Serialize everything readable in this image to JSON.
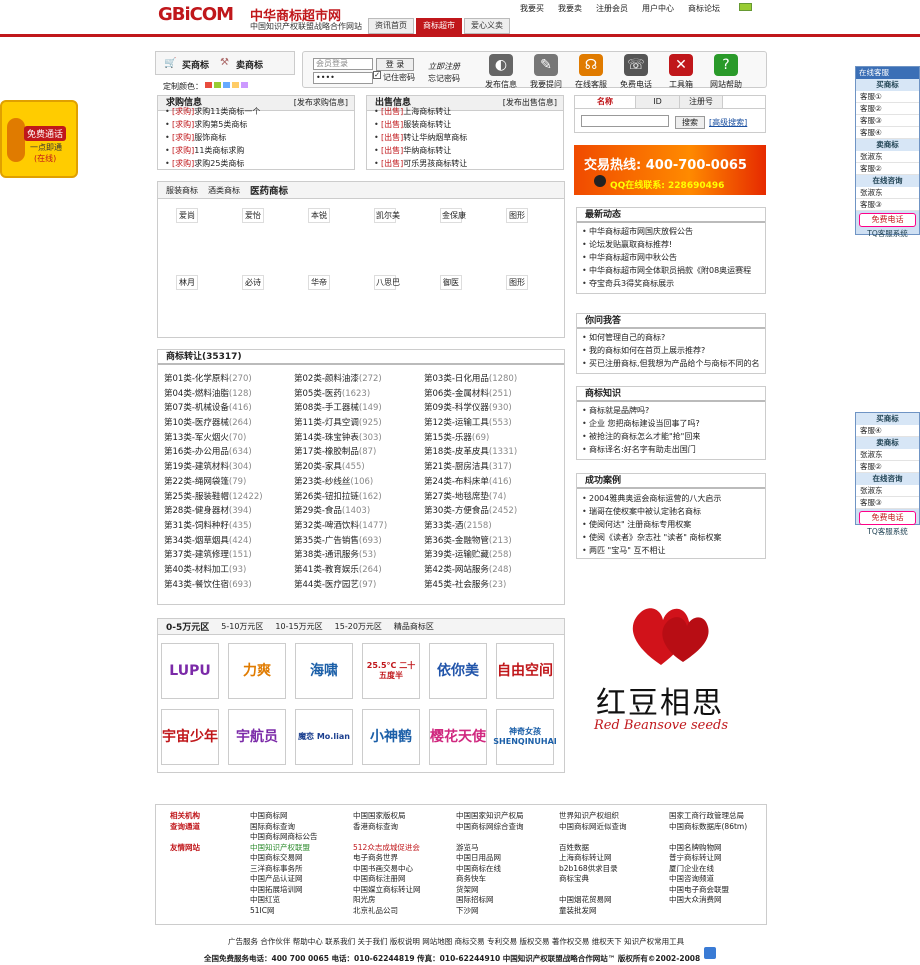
{
  "header": {
    "logo_text": "GBiCOM",
    "title": "中华商标超市网",
    "subtitle": "中国知识产权联盟战略合作网站",
    "tabs": [
      "资讯首页",
      "商标超市",
      "爱心义卖"
    ],
    "toplinks": [
      "我要买",
      "我要卖",
      "注册会员",
      "用户中心",
      "商标论坛"
    ]
  },
  "toolbar": {
    "buy": "买商标",
    "sell": "卖商标",
    "color_label": "定制颜色：",
    "member_placeholder": "会员登录",
    "pwd_value": "••••",
    "login": "登 录",
    "remember": "记住密码",
    "register": "立即注册",
    "forgot": "忘记密码",
    "icons": [
      {
        "name": "speaker-icon",
        "label": "发布信息",
        "color": "#666",
        "glyph": "◐"
      },
      {
        "name": "pencil-icon",
        "label": "我要提问",
        "color": "#777",
        "glyph": "✎"
      },
      {
        "name": "headset-icon",
        "label": "在线客服",
        "color": "#e07b00",
        "glyph": "☊"
      },
      {
        "name": "phone-icon",
        "label": "免费电话",
        "color": "#555",
        "glyph": "☏"
      },
      {
        "name": "tools-icon",
        "label": "工具箱",
        "color": "#c0171b",
        "glyph": "✕"
      },
      {
        "name": "help-icon",
        "label": "网站帮助",
        "color": "#2a9a2a",
        "glyph": "?"
      }
    ]
  },
  "callbox": {
    "line1": "免费通话",
    "line2": "一点即通",
    "line3": "(在线)"
  },
  "buy": {
    "title": "求购信息",
    "more": "[发布求购信息]",
    "items": [
      {
        "tag": "[求购]",
        "text": "求购11类商标一个"
      },
      {
        "tag": "[求购]",
        "text": "求购第5类商标"
      },
      {
        "tag": "[求购]",
        "text": "服饰商标"
      },
      {
        "tag": "[求购]",
        "text": "11类商标求购"
      },
      {
        "tag": "[求购]",
        "text": "求购25类商标"
      }
    ]
  },
  "sell": {
    "title": "出售信息",
    "more": "[发布出售信息]",
    "items": [
      {
        "tag": "[出售]",
        "text": "上海商标转让"
      },
      {
        "tag": "[出售]",
        "text": "服装商标转让"
      },
      {
        "tag": "[出售]",
        "text": "转让华纳烟草商标"
      },
      {
        "tag": "[出售]",
        "text": "华纳商标转让"
      },
      {
        "tag": "[出售]",
        "text": "可乐男孩商标转让"
      }
    ]
  },
  "search": {
    "tabs": [
      "名称",
      "ID",
      "注册号"
    ],
    "button": "搜索",
    "advanced": "[高级搜索]"
  },
  "hotline": {
    "title": "交易热线: 400-700-0065",
    "qq": "QQ在线联系: 228690496"
  },
  "brands": {
    "tabs": [
      "服装商标",
      "酒类商标",
      "医药商标"
    ],
    "row1": [
      "爱尚",
      "爱怡",
      "本锐",
      "凯尔美",
      "金保康",
      "图形"
    ],
    "row2": [
      "林月",
      "必诗",
      "华帝",
      "八思巴",
      "御医",
      "图形"
    ]
  },
  "news": {
    "title": "最新动态",
    "items": [
      "中华商标超市网国庆放假公告",
      "论坛发贴赢取商标推荐!",
      "中华商标超市网中秋公告",
      "中华商标超市网全体职员捐款《附08奥运赛程",
      "夺宝奇兵3得奖商标展示"
    ]
  },
  "qa": {
    "title": "你问我答",
    "items": [
      "如何管理自己的商标?",
      "我的商标如何在首页上展示推荐?",
      "买已注册商标,但我想为产品给个与商标不同的名"
    ]
  },
  "knowledge": {
    "title": "商标知识",
    "items": [
      "商标就是品牌吗?",
      "企业 您把商标建设当回事了吗?",
      "被抢注的商标怎么才能\"抢\"回来",
      "商标译名:好名字有助走出国门"
    ]
  },
  "cases": {
    "title": "成功案例",
    "items": [
      "2004雅典奥运会商标运营的八大启示",
      "瑞哥在使权案中被认定驰名商标",
      "使阅何达\" 注册商标专用权案",
      "使阅《读者》杂志社 \"读者\" 商标权案",
      "两匹 \"宝马\" 互不相让"
    ]
  },
  "categories": {
    "title": "商标转让",
    "count": "(35317)",
    "items": [
      {
        "t": "第01类-化学原料",
        "n": "(270)"
      },
      {
        "t": "第02类-颜料油漆",
        "n": "(272)"
      },
      {
        "t": "第03类-日化用品",
        "n": "(1280)"
      },
      {
        "t": "第04类-燃料油脂",
        "n": "(128)"
      },
      {
        "t": "第05类-医药",
        "n": "(1623)"
      },
      {
        "t": "第06类-金属材料",
        "n": "(251)"
      },
      {
        "t": "第07类-机械设备",
        "n": "(416)"
      },
      {
        "t": "第08类-手工器械",
        "n": "(149)"
      },
      {
        "t": "第09类-科学仪器",
        "n": "(930)"
      },
      {
        "t": "第10类-医疗器械",
        "n": "(264)"
      },
      {
        "t": "第11类-灯具空调",
        "n": "(925)"
      },
      {
        "t": "第12类-运输工具",
        "n": "(553)"
      },
      {
        "t": "第13类-军火烟火",
        "n": "(70)"
      },
      {
        "t": "第14类-珠宝钟表",
        "n": "(303)"
      },
      {
        "t": "第15类-乐器",
        "n": "(69)"
      },
      {
        "t": "第16类-办公用品",
        "n": "(634)"
      },
      {
        "t": "第17类-橡胶制品",
        "n": "(87)"
      },
      {
        "t": "第18类-皮革皮具",
        "n": "(1331)"
      },
      {
        "t": "第19类-建筑材料",
        "n": "(304)"
      },
      {
        "t": "第20类-家具",
        "n": "(455)"
      },
      {
        "t": "第21类-厨房洁具",
        "n": "(317)"
      },
      {
        "t": "第22类-绳网袋篷",
        "n": "(79)"
      },
      {
        "t": "第23类-纱线丝",
        "n": "(106)"
      },
      {
        "t": "第24类-布料床单",
        "n": "(416)"
      },
      {
        "t": "第25类-服装鞋帽",
        "n": "(12422)"
      },
      {
        "t": "第26类-钮扣拉链",
        "n": "(162)"
      },
      {
        "t": "第27类-地毯席垫",
        "n": "(74)"
      },
      {
        "t": "第28类-健身器材",
        "n": "(394)"
      },
      {
        "t": "第29类-食品",
        "n": "(1403)"
      },
      {
        "t": "第30类-方便食品",
        "n": "(2452)"
      },
      {
        "t": "第31类-饲料种籽",
        "n": "(435)"
      },
      {
        "t": "第32类-啤酒饮料",
        "n": "(1477)"
      },
      {
        "t": "第33类-酒",
        "n": "(2158)"
      },
      {
        "t": "第34类-烟草烟具",
        "n": "(424)"
      },
      {
        "t": "第35类-广告销售",
        "n": "(693)"
      },
      {
        "t": "第36类-金融物管",
        "n": "(213)"
      },
      {
        "t": "第37类-建筑修理",
        "n": "(151)"
      },
      {
        "t": "第38类-通讯服务",
        "n": "(53)"
      },
      {
        "t": "第39类-运输贮藏",
        "n": "(258)"
      },
      {
        "t": "第40类-材料加工",
        "n": "(93)"
      },
      {
        "t": "第41类-教育娱乐",
        "n": "(264)"
      },
      {
        "t": "第42类-网站服务",
        "n": "(248)"
      },
      {
        "t": "第43类-餐饮住宿",
        "n": "(693)"
      },
      {
        "t": "第44类-医疗园艺",
        "n": "(97)"
      },
      {
        "t": "第45类-社会服务",
        "n": "(23)"
      }
    ]
  },
  "price": {
    "tabs": [
      "0-5万元区",
      "5-10万元区",
      "10-15万元区",
      "15-20万元区",
      "精品商标区"
    ],
    "marks": [
      {
        "text": "LUPU",
        "color": "#7b2aa8"
      },
      {
        "text": "力爽",
        "color": "#e07b00"
      },
      {
        "text": "海啸",
        "color": "#1b5fa8"
      },
      {
        "text": "25.5°C 二十五度半",
        "color": "#c0171b"
      },
      {
        "text": "依你美",
        "color": "#2255aa"
      },
      {
        "text": "自由空间",
        "color": "#c0171b"
      },
      {
        "text": "宇宙少年",
        "color": "#c0171b"
      },
      {
        "text": "宇航员",
        "color": "#7b2aa8"
      },
      {
        "text": "魔恋 Mo.lian",
        "color": "#1b3f8f"
      },
      {
        "text": "小神鹤",
        "color": "#1b5fa8"
      },
      {
        "text": "樱花天使",
        "color": "#d0287f"
      },
      {
        "text": "神奇女孩 SHENQINUHAI",
        "color": "#1b5fa8"
      }
    ]
  },
  "ad": {
    "cn": "红豆相思",
    "en": "Red Beansove seeds"
  },
  "footer": {
    "rows": [
      [
        "相关机构",
        "中国商标网",
        "中国国家版权局",
        "中国国家知识产权局",
        "世界知识产权组织",
        "国家工商行政管理总局"
      ],
      [
        "查询通道",
        "国际商标查询",
        "香港商标查询",
        "中国商标网综合查询",
        "中国商标网近似查询",
        "中国商标数据库(86tm)"
      ],
      [
        "",
        "中国商标网商标公告",
        "",
        "",
        "",
        ""
      ],
      [
        "友情网站",
        "中国知识产权联盟",
        "512众志成城促进会",
        "游览马",
        "百姓数据",
        "中国名牌购物网"
      ],
      [
        "",
        "中国商标交易网",
        "电子商务世界",
        "中国日用品网",
        "上海商标转让网",
        "普宁商标转让网"
      ],
      [
        "",
        "三洋商标事务所",
        "中国书画交易中心",
        "中国商标在线",
        "b2b168供求目录",
        "厦门企业在线"
      ],
      [
        "",
        "中国产品认证网",
        "中国商标注册网",
        "商务快车",
        "商标宝典",
        "中国咨询频道"
      ],
      [
        "",
        "中国拓展培训网",
        "中国媒立商标转让网",
        "货架网",
        "",
        "中国电子商会联盟"
      ],
      [
        "",
        "中国红览",
        "阳光房",
        "国际招标网",
        "中国烟花贸易网",
        "中国大众消费网"
      ],
      [
        "",
        "51IC网",
        "北京礼品公司",
        "下沙网",
        "童装批发网",
        ""
      ]
    ],
    "links": "广告服务 合作伙伴 帮助中心 联系我们 关于我们 版权说明 网站地图 商标交易 专利交易 版权交易 著作权交易 维权天下 知识产权常用工具",
    "contact": "全国免费服务电话：400 700 0065 电话：010-62244819 传真：010-62244910 中国知识产权联盟战略合作网站™ 版权所有©2002-2008"
  },
  "side": {
    "top_title": "在线客服",
    "groups1": [
      {
        "h": "买商标",
        "rows": [
          "客服①",
          "客服②",
          "客服③",
          "客服④"
        ]
      },
      {
        "h": "卖商标",
        "rows": [
          "张淑东",
          "客服②"
        ]
      },
      {
        "h": "在线咨询",
        "rows": [
          "张淑东",
          "客服③"
        ]
      }
    ],
    "call": "免费电话",
    "sys": "TQ客服系统",
    "groups2": [
      {
        "h": "买商标",
        "rows": [
          "客服④"
        ]
      },
      {
        "h": "卖商标",
        "rows": [
          "张淑东",
          "客服②"
        ]
      },
      {
        "h": "在线咨询",
        "rows": [
          "张淑东",
          "客服③"
        ]
      }
    ]
  }
}
